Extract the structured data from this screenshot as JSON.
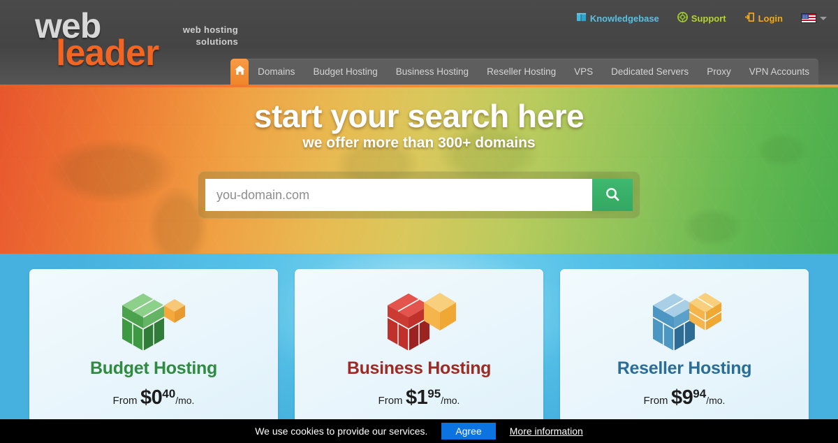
{
  "header": {
    "logo": {
      "word1": "web",
      "word2": "leader",
      "tagline_line1": "web hosting",
      "tagline_line2": "solutions",
      "word1_color": "#d8d8d8",
      "word2_color": "#f26522"
    },
    "toplinks": [
      {
        "label": "Knowledgebase",
        "icon": "book-icon",
        "color": "#5bbfe0"
      },
      {
        "label": "Support",
        "icon": "lifebuoy-icon",
        "color": "#b5d334"
      },
      {
        "label": "Login",
        "icon": "login-arrow-icon",
        "color": "#f0a81e"
      }
    ],
    "language": {
      "icon": "us-flag-icon",
      "caret": "chevron-down-icon"
    }
  },
  "nav": {
    "home_icon": "home-icon",
    "active_index": 0,
    "items": [
      {
        "label": "Domains"
      },
      {
        "label": "Budget Hosting"
      },
      {
        "label": "Business Hosting"
      },
      {
        "label": "Reseller Hosting"
      },
      {
        "label": "VPS"
      },
      {
        "label": "Dedicated Servers"
      },
      {
        "label": "Proxy"
      },
      {
        "label": "VPN Accounts"
      }
    ]
  },
  "hero": {
    "title": "start your search here",
    "subtitle": "we offer more than 300+ domains",
    "search": {
      "placeholder": "you-domain.com",
      "value": "",
      "button_icon": "search-icon",
      "button_color": "#36ae67"
    }
  },
  "plans": [
    {
      "title": "Budget Hosting",
      "title_color": "#2e8b40",
      "icon": "cube-icon-green",
      "from_label": "From",
      "currency": "$",
      "dollars": "0",
      "cents": "40",
      "period": "/mo.",
      "cube_colors": {
        "top": "#8dd08a",
        "left": "#3d9a43",
        "right": "#2f7d38",
        "accent": "#f5a93c"
      }
    },
    {
      "title": "Business Hosting",
      "title_color": "#9e2a24",
      "icon": "cube-icon-red",
      "from_label": "From",
      "currency": "$",
      "dollars": "1",
      "cents": "95",
      "period": "/mo.",
      "cube_colors": {
        "top": "#e3544c",
        "left": "#c0312c",
        "right": "#9c2420",
        "accent": "#f6b54a"
      }
    },
    {
      "title": "Reseller Hosting",
      "title_color": "#2a6d96",
      "icon": "cube-icon-blue",
      "from_label": "From",
      "currency": "$",
      "dollars": "9",
      "cents": "94",
      "period": "/mo.",
      "cube_colors": {
        "top": "#a8cfe6",
        "left": "#4c96c4",
        "right": "#2d6d95",
        "accent": "#f6b54a"
      }
    }
  ],
  "cookiebar": {
    "message": "We use cookies to provide our services.",
    "agree_label": "Agree",
    "more_label": "More information",
    "agree_color": "#0b74e0"
  }
}
